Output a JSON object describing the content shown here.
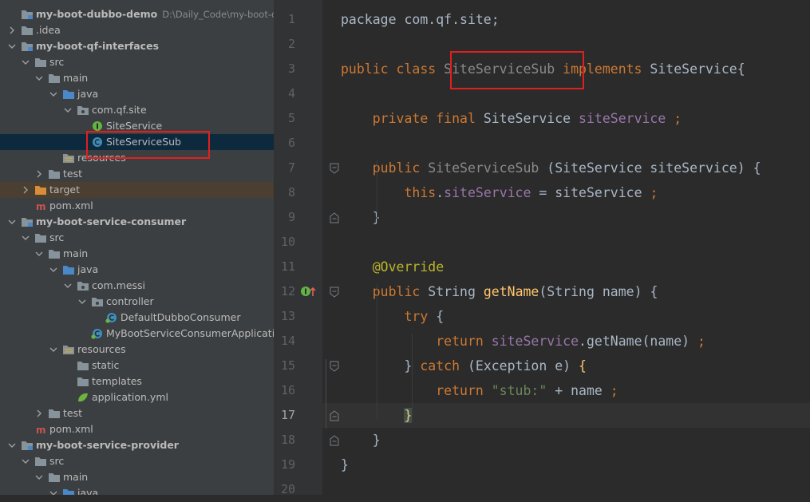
{
  "project_tree": {
    "items": [
      {
        "label": "my-boot-dubbo-demo",
        "path": "D:\\Daily_Code\\my-boot-dubb",
        "icon": "module-folder-icon",
        "arrow": "none",
        "bold": true
      },
      {
        "label": ".idea",
        "icon": "folder-icon",
        "arrow": "collapsed"
      },
      {
        "label": "my-boot-qf-interfaces",
        "icon": "module-folder-icon",
        "arrow": "expanded",
        "bold": true
      },
      {
        "label": "src",
        "icon": "folder-icon",
        "arrow": "expanded"
      },
      {
        "label": "main",
        "icon": "folder-icon",
        "arrow": "expanded"
      },
      {
        "label": "java",
        "icon": "source-folder-icon",
        "arrow": "expanded"
      },
      {
        "label": "com.qf.site",
        "icon": "package-icon",
        "arrow": "expanded"
      },
      {
        "label": "SiteService",
        "icon": "interface-icon",
        "arrow": "none"
      },
      {
        "label": "SiteServiceSub",
        "icon": "class-icon",
        "arrow": "none",
        "selected": true
      },
      {
        "label": "resources",
        "icon": "resources-folder-icon",
        "arrow": "none"
      },
      {
        "label": "test",
        "icon": "folder-icon",
        "arrow": "collapsed"
      },
      {
        "label": "target",
        "icon": "excluded-folder-icon",
        "arrow": "collapsed",
        "target": true
      },
      {
        "label": "pom.xml",
        "icon": "maven-icon",
        "arrow": "none"
      },
      {
        "label": "my-boot-service-consumer",
        "icon": "module-folder-icon",
        "arrow": "expanded",
        "bold": true
      },
      {
        "label": "src",
        "icon": "folder-icon",
        "arrow": "expanded"
      },
      {
        "label": "main",
        "icon": "folder-icon",
        "arrow": "expanded"
      },
      {
        "label": "java",
        "icon": "source-folder-icon",
        "arrow": "expanded"
      },
      {
        "label": "com.messi",
        "icon": "package-icon",
        "arrow": "expanded"
      },
      {
        "label": "controller",
        "icon": "package-icon",
        "arrow": "expanded"
      },
      {
        "label": "DefaultDubboConsumer",
        "icon": "spring-class-icon",
        "arrow": "none"
      },
      {
        "label": "MyBootServiceConsumerApplication",
        "icon": "spring-class-icon",
        "arrow": "none"
      },
      {
        "label": "resources",
        "icon": "resources-folder-icon",
        "arrow": "expanded"
      },
      {
        "label": "static",
        "icon": "folder-icon",
        "arrow": "none"
      },
      {
        "label": "templates",
        "icon": "folder-icon",
        "arrow": "none"
      },
      {
        "label": "application.yml",
        "icon": "spring-leaf-icon",
        "arrow": "none"
      },
      {
        "label": "test",
        "icon": "folder-icon",
        "arrow": "collapsed"
      },
      {
        "label": "pom.xml",
        "icon": "maven-icon",
        "arrow": "none"
      },
      {
        "label": "my-boot-service-provider",
        "icon": "module-folder-icon",
        "arrow": "expanded",
        "bold": true
      },
      {
        "label": "src",
        "icon": "folder-icon",
        "arrow": "expanded"
      },
      {
        "label": "main",
        "icon": "folder-icon",
        "arrow": "expanded"
      },
      {
        "label": "java",
        "icon": "source-folder-icon",
        "arrow": "expanded"
      }
    ]
  },
  "editor": {
    "current_line": 17,
    "lines": [
      {
        "n": "1",
        "tokens": [
          {
            "t": "package com.qf.site;",
            "c": ""
          }
        ]
      },
      {
        "n": "2",
        "tokens": []
      },
      {
        "n": "3",
        "tokens": [
          {
            "t": "public class ",
            "c": "kw"
          },
          {
            "t": "SiteServiceSub",
            "c": "gray"
          },
          {
            "t": " ",
            "c": ""
          },
          {
            "t": "implements",
            "c": "kw"
          },
          {
            "t": " SiteService{",
            "c": ""
          }
        ]
      },
      {
        "n": "4",
        "tokens": []
      },
      {
        "n": "5",
        "tokens": [
          {
            "t": "    private final ",
            "c": "kw"
          },
          {
            "t": "SiteService ",
            "c": ""
          },
          {
            "t": "siteService",
            "c": "fld"
          },
          {
            "t": " ;",
            "c": "kw"
          }
        ]
      },
      {
        "n": "6",
        "tokens": []
      },
      {
        "n": "7",
        "tokens": [
          {
            "t": "    public ",
            "c": "kw"
          },
          {
            "t": "SiteServiceSub",
            "c": "gray"
          },
          {
            "t": " (SiteService siteService) {",
            "c": ""
          }
        ]
      },
      {
        "n": "8",
        "tokens": [
          {
            "t": "        this",
            "c": "kw"
          },
          {
            "t": ".",
            "c": ""
          },
          {
            "t": "siteService",
            "c": "fld"
          },
          {
            "t": " = siteService ",
            "c": ""
          },
          {
            "t": ";",
            "c": "kw"
          }
        ]
      },
      {
        "n": "9",
        "tokens": [
          {
            "t": "    }",
            "c": ""
          }
        ]
      },
      {
        "n": "10",
        "tokens": []
      },
      {
        "n": "11",
        "tokens": [
          {
            "t": "    @Override",
            "c": "ann"
          }
        ]
      },
      {
        "n": "12",
        "tokens": [
          {
            "t": "    public ",
            "c": "kw"
          },
          {
            "t": "String ",
            "c": ""
          },
          {
            "t": "getName",
            "c": "fn"
          },
          {
            "t": "(String name) {",
            "c": ""
          }
        ]
      },
      {
        "n": "13",
        "tokens": [
          {
            "t": "        try",
            "c": "kw"
          },
          {
            "t": " {",
            "c": ""
          }
        ]
      },
      {
        "n": "14",
        "tokens": [
          {
            "t": "            return ",
            "c": "kw"
          },
          {
            "t": "siteService",
            "c": "fld"
          },
          {
            "t": ".getName(name) ",
            "c": ""
          },
          {
            "t": ";",
            "c": "kw"
          }
        ]
      },
      {
        "n": "15",
        "tokens": [
          {
            "t": "        } ",
            "c": ""
          },
          {
            "t": "catch",
            "c": "kw"
          },
          {
            "t": " (Exception e) ",
            "c": ""
          },
          {
            "t": "{",
            "c": "fn"
          }
        ]
      },
      {
        "n": "16",
        "tokens": [
          {
            "t": "            return ",
            "c": "kw"
          },
          {
            "t": "\"stub:\"",
            "c": "str"
          },
          {
            "t": " + name ",
            "c": ""
          },
          {
            "t": ";",
            "c": "kw"
          }
        ]
      },
      {
        "n": "17",
        "tokens": [
          {
            "t": "        ",
            "c": ""
          },
          {
            "t": "}",
            "c": "fn brace-hl"
          }
        ]
      },
      {
        "n": "18",
        "tokens": [
          {
            "t": "    }",
            "c": ""
          }
        ]
      },
      {
        "n": "19",
        "tokens": [
          {
            "t": "}",
            "c": ""
          }
        ]
      },
      {
        "n": "20",
        "tokens": []
      }
    ]
  },
  "colors": {
    "selection": "#0d293e",
    "keyword": "#cc7832",
    "field": "#9876aa",
    "annotation": "#bbb529",
    "method": "#ffc66d",
    "string": "#6a8759",
    "highlight_box": "#e02020"
  }
}
